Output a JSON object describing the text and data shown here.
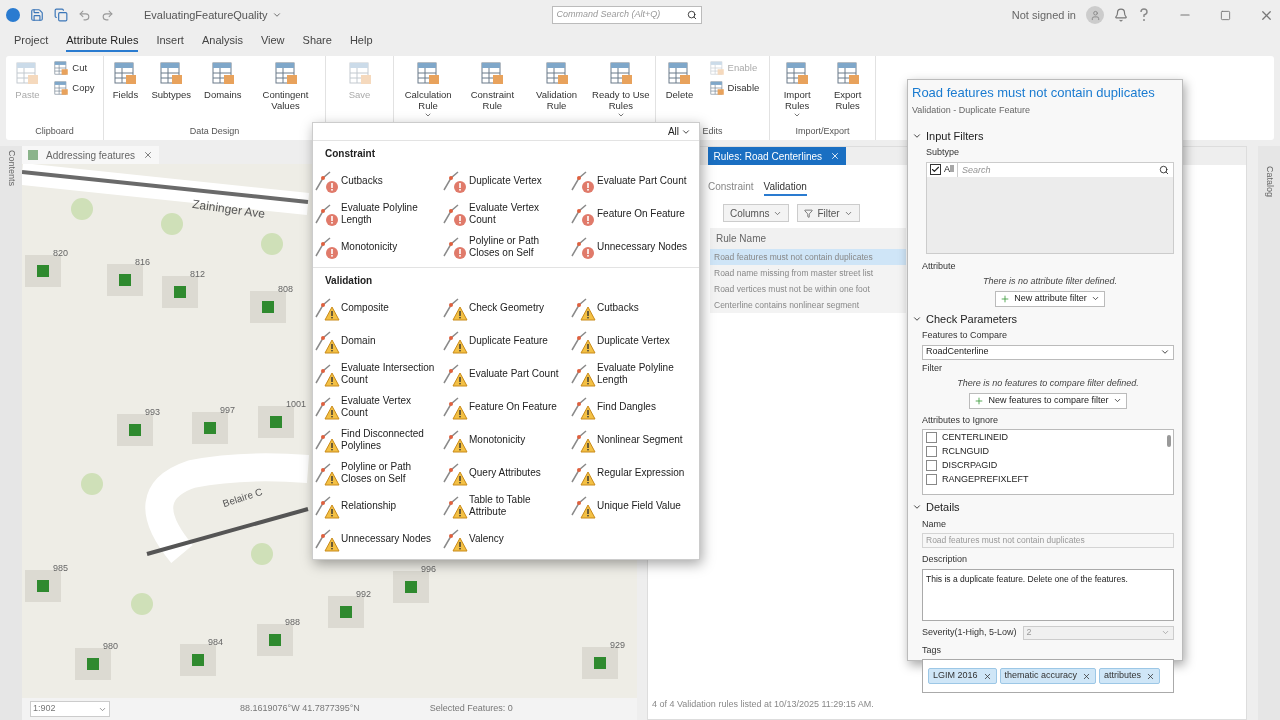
{
  "title_bar": {
    "title": "EvaluatingFeatureQuality",
    "search_placeholder": "Command Search (Alt+Q)",
    "user": "Not signed in"
  },
  "menu_tabs": [
    {
      "label": "Project",
      "selected": false
    },
    {
      "label": "Attribute Rules",
      "selected": true
    },
    {
      "label": "Insert",
      "selected": false
    },
    {
      "label": "Analysis",
      "selected": false
    },
    {
      "label": "View",
      "selected": false
    },
    {
      "label": "Share",
      "selected": false
    },
    {
      "label": "Help",
      "selected": false
    }
  ],
  "ribbon": [
    {
      "label": "Clipboard",
      "buttons": [
        {
          "label": "Paste",
          "kind": "large",
          "disabled": true,
          "has_menu": false
        },
        {
          "label": "Cut",
          "kind": "small",
          "disabled": false
        },
        {
          "label": "Copy",
          "kind": "small",
          "disabled": false
        }
      ]
    },
    {
      "label": "Data Design",
      "buttons": [
        {
          "label": "Fields",
          "kind": "large",
          "disabled": false,
          "has_menu": false
        },
        {
          "label": "Subtypes",
          "kind": "large",
          "disabled": false,
          "has_menu": false
        },
        {
          "label": "Domains",
          "kind": "large",
          "disabled": false,
          "has_menu": false
        },
        {
          "label": "Contingent Values",
          "kind": "large",
          "disabled": false,
          "has_menu": false
        }
      ]
    },
    {
      "buttons": [
        {
          "label": "Save",
          "kind": "large",
          "disabled": true,
          "has_menu": false
        }
      ]
    },
    {
      "buttons": [
        {
          "label": "Calculation Rule",
          "kind": "large",
          "disabled": false,
          "has_menu": true
        },
        {
          "label": "Constraint Rule",
          "kind": "large",
          "disabled": false,
          "has_menu": false
        },
        {
          "label": "Validation Rule",
          "kind": "large",
          "disabled": false,
          "has_menu": false
        },
        {
          "label": "Ready to Use Rules",
          "kind": "large",
          "disabled": false,
          "has_menu": true
        }
      ]
    },
    {
      "label": "Edits",
      "buttons": [
        {
          "label": "Delete",
          "kind": "large",
          "disabled": false,
          "has_menu": false
        },
        {
          "label": "Enable",
          "kind": "small",
          "disabled": true
        },
        {
          "label": "Disable",
          "kind": "small",
          "disabled": false
        }
      ]
    },
    {
      "label": "Import/Export",
      "buttons": [
        {
          "label": "Import Rules",
          "kind": "large",
          "disabled": false,
          "has_menu": true
        },
        {
          "label": "Export Rules",
          "kind": "large",
          "disabled": false,
          "has_menu": false
        }
      ]
    }
  ],
  "left_dock": {
    "label": "Contents"
  },
  "right_dock": {
    "label": "Catalog"
  },
  "map": {
    "tab": "Addressing features",
    "streets": [
      "Zaininger Ave",
      "Belaire C"
    ],
    "addresses": [
      "820",
      "816",
      "812",
      "808",
      "993",
      "997",
      "1001",
      "985",
      "996",
      "992",
      "988",
      "980",
      "984",
      "929"
    ],
    "scale": "1:902",
    "coordinates": "88.1619076°W 41.7877395°N",
    "selected_features": "Selected Features: 0"
  },
  "rules_pane": {
    "tab": "Rules: Road Centerlines",
    "subtabs": [
      {
        "label": "Constraint",
        "selected": false
      },
      {
        "label": "Validation",
        "selected": true
      }
    ],
    "buttons": [
      "Columns",
      "Filter"
    ],
    "column": "Rule Name",
    "rows": [
      {
        "name": "Road features must not contain duplicates",
        "selected": true
      },
      {
        "name": "Road name missing from master street list",
        "selected": false
      },
      {
        "name": "Road vertices must not be within one foot",
        "selected": false
      },
      {
        "name": "Centerline contains nonlinear segment",
        "selected": false
      }
    ],
    "status": "4 of 4 Validation rules listed at 10/13/2025 11:29:15 AM."
  },
  "rule_gallery": {
    "filter": "All",
    "sections": [
      {
        "title": "Constraint",
        "kind": "error",
        "items": [
          "Cutbacks",
          "Duplicate Vertex",
          "Evaluate Part Count",
          "Evaluate Polyline Length",
          "Evaluate Vertex Count",
          "Feature On Feature",
          "Monotonicity",
          "Polyline or Path Closes on Self",
          "Unnecessary Nodes"
        ]
      },
      {
        "title": "Validation",
        "kind": "warning",
        "items": [
          "Composite",
          "Check Geometry",
          "Cutbacks",
          "Domain",
          "Duplicate Feature",
          "Duplicate Vertex",
          "Evaluate Intersection Count",
          "Evaluate Part Count",
          "Evaluate Polyline Length",
          "Evaluate Vertex Count",
          "Feature On Feature",
          "Find Dangles",
          "Find Disconnected Polylines",
          "Monotonicity",
          "Nonlinear Segment",
          "Polyline or Path Closes on Self",
          "Query Attributes",
          "Regular Expression",
          "Relationship",
          "Table to Table Attribute",
          "Unique Field Value",
          "Unnecessary Nodes",
          "Valency"
        ]
      }
    ]
  },
  "rule_details": {
    "title": "Road features must not contain duplicates",
    "subtitle": "Validation - Duplicate Feature",
    "input_filters": {
      "heading": "Input Filters",
      "expanded": true,
      "subtype_label": "Subtype",
      "subtype_all": {
        "label": "All",
        "checked": true
      },
      "search_placeholder": "Search",
      "attribute_label": "Attribute",
      "attribute_note": "There is no attribute filter defined.",
      "attribute_button": "New attribute filter"
    },
    "check_parameters": {
      "heading": "Check Parameters",
      "expanded": true,
      "features_label": "Features to Compare",
      "features_value": "RoadCenterline",
      "filter_label": "Filter",
      "filter_note": "There is no features to compare filter defined.",
      "filter_button": "New features to compare filter",
      "ignore_label": "Attributes to Ignore",
      "ignore_items": [
        {
          "label": "CENTERLINEID",
          "checked": false
        },
        {
          "label": "RCLNGUID",
          "checked": false
        },
        {
          "label": "DISCRPAGID",
          "checked": false
        },
        {
          "label": "RANGEPREFIXLEFT",
          "checked": false
        }
      ]
    },
    "details": {
      "heading": "Details",
      "expanded": true,
      "name_label": "Name",
      "name_value": "Road features must not contain duplicates",
      "description_label": "Description",
      "description_value": "This is a duplicate feature. Delete one of the features.",
      "severity_label": "Severity(1-High, 5-Low)",
      "severity_value": "2",
      "tags_label": "Tags",
      "tags": [
        "LGIM 2016",
        "thematic accuracy",
        "attributes"
      ]
    }
  }
}
